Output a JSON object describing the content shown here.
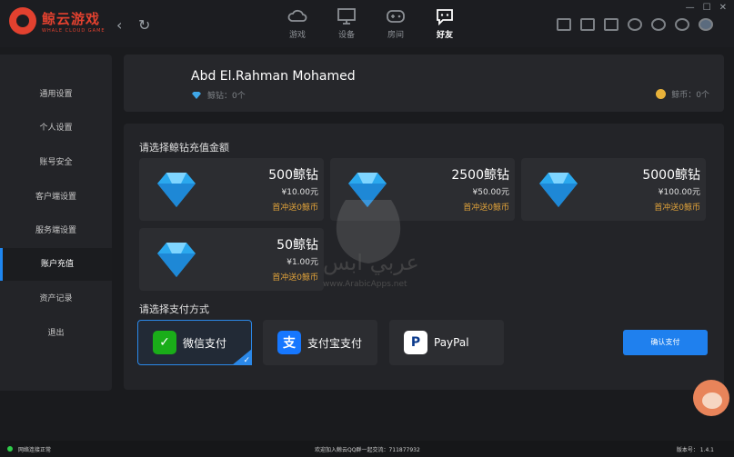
{
  "app": {
    "name_cn": "鲸云游戏",
    "name_en": "WHALE CLOUD GAME"
  },
  "nav": {
    "back": "‹",
    "refresh": "↻",
    "tabs": [
      {
        "label": "游戏",
        "icon": "cloud-icon"
      },
      {
        "label": "设备",
        "icon": "monitor-icon"
      },
      {
        "label": "房间",
        "icon": "gamepad-icon"
      },
      {
        "label": "好友",
        "icon": "chat-icon"
      }
    ],
    "active_tab": "好友"
  },
  "window_controls": {
    "min": "—",
    "max": "☐",
    "close": "✕"
  },
  "sidebar": {
    "items": [
      {
        "label": "通用设置"
      },
      {
        "label": "个人设置"
      },
      {
        "label": "账号安全"
      },
      {
        "label": "客户端设置"
      },
      {
        "label": "服务端设置"
      },
      {
        "label": "账户充值"
      },
      {
        "label": "资产记录"
      },
      {
        "label": "退出"
      }
    ],
    "active": "账户充值"
  },
  "profile": {
    "username": "Abd El.Rahman Mohamed",
    "diamond_label": "鲸钻：0个",
    "coin_label": "鲸币：0个"
  },
  "recharge": {
    "amount_title": "请选择鲸钻充值金额",
    "packages": [
      {
        "name": "500鲸钻",
        "price": "¥10.00元",
        "bonus": "首冲送0鲸币"
      },
      {
        "name": "2500鲸钻",
        "price": "¥50.00元",
        "bonus": "首冲送0鲸币"
      },
      {
        "name": "5000鲸钻",
        "price": "¥100.00元",
        "bonus": "首冲送0鲸币"
      },
      {
        "name": "50鲸钻",
        "price": "¥1.00元",
        "bonus": "首冲送0鲸币"
      }
    ],
    "payment_title": "请选择支付方式",
    "payment_methods": [
      {
        "label": "微信支付",
        "icon": "wechat-icon",
        "icon_text": "✓",
        "color": "#1aad19"
      },
      {
        "label": "支付宝支付",
        "icon": "alipay-icon",
        "icon_text": "支",
        "color": "#1677ff"
      },
      {
        "label": "PayPal",
        "icon": "paypal-icon",
        "icon_text": "P",
        "color": "#ffffff"
      }
    ],
    "selected_payment": "微信支付",
    "confirm_label": "确认支付"
  },
  "watermark": {
    "text": "عربي ابس",
    "sub": "www.ArabicApps.net"
  },
  "statusbar": {
    "network": "网络连接正常",
    "welcome": "欢迎加入鲸云QQ群一起交流：711877932",
    "version": "版本号：   1.4.1"
  },
  "colors": {
    "accent": "#1f80ee",
    "brand": "#e2412f",
    "bonus": "#e0a23a",
    "online": "#2fcc4a"
  }
}
